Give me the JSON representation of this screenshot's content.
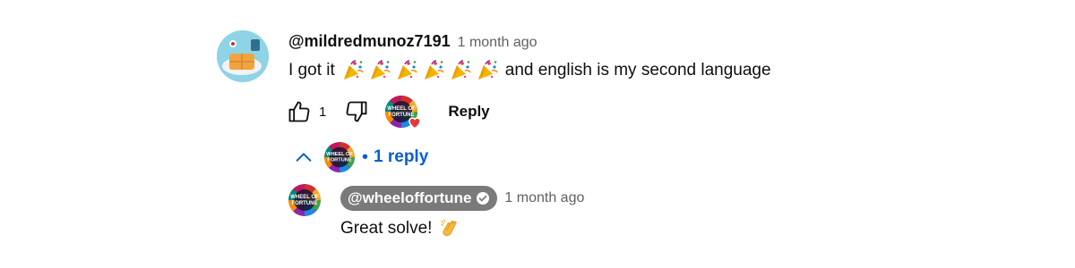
{
  "comment": {
    "author": "@mildredmunoz7191",
    "timestamp": "1 month ago",
    "text_before": "I got it",
    "emoji_count": 6,
    "emoji_icon": "party-popper-icon",
    "text_after": "and english is my second language",
    "like_count": "1",
    "reply_label": "Reply",
    "hearted_by_creator": true
  },
  "replies_toggle": {
    "label": "1 reply",
    "separator": "•",
    "expanded": true
  },
  "reply": {
    "author": "@wheeloffortune",
    "verified": true,
    "timestamp": "1 month ago",
    "text": "Great solve!",
    "emoji_icon": "clapping-hands-icon"
  },
  "colors": {
    "link_blue": "#065fd4",
    "badge_gray": "#7a7a7a",
    "muted_text": "#606060",
    "heart_red": "#e53935"
  }
}
